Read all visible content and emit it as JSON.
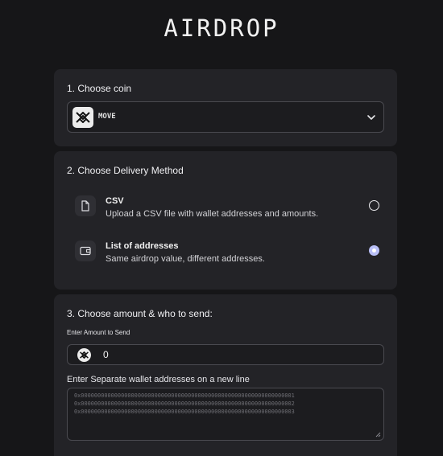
{
  "page": {
    "title": "AIRDROP"
  },
  "coin_section": {
    "heading": "1. Choose coin",
    "selected_coin": "MOVE",
    "logo_icon": "move-logo-icon",
    "dropdown_icon": "chevron-down-icon"
  },
  "delivery_section": {
    "heading": "2. Choose Delivery Method",
    "options": [
      {
        "title": "CSV",
        "description": "Upload a CSV file with wallet addresses and amounts.",
        "icon": "file-icon",
        "selected": false
      },
      {
        "title": "List of addresses",
        "description": "Same airdrop value, different addresses.",
        "icon": "wallet-icon",
        "selected": true
      }
    ],
    "selected_color": "#b9bff7"
  },
  "amount_section": {
    "heading": "3. Choose amount & who to send:",
    "amount_label": "Enter Amount to Send",
    "amount_value": "0",
    "addresses_label": "Enter Separate wallet addresses on a new line",
    "addresses_placeholder": [
      "0x0000000000000000000000000000000000000000000000000000000000000001",
      "0x0000000000000000000000000000000000000000000000000000000000000002",
      "0x0000000000000000000000000000000000000000000000000000000000000003"
    ]
  },
  "theme": {
    "background": "#161618",
    "card": "#232327",
    "border": "#4a4a50"
  }
}
